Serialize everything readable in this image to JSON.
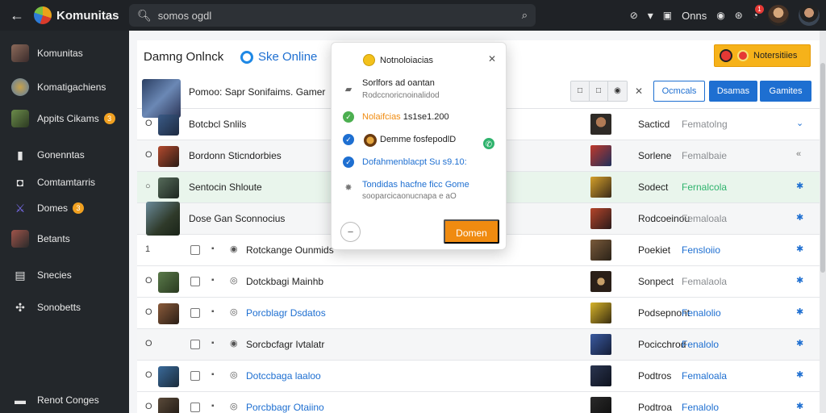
{
  "topbar": {
    "brand": "Komunitas",
    "search_value": "somos ogdl",
    "right_text": "Onns",
    "notif_count": "1",
    "icons": [
      "back-arrow-icon",
      "search-icon",
      "chevron-down-icon",
      "clipboard-icon",
      "chat-icon",
      "search-icon",
      "notification-icon"
    ]
  },
  "sidebar": {
    "items": [
      {
        "label": "Komunitas"
      },
      {
        "label": "Komatigachiens"
      },
      {
        "label": "Appits Cikams",
        "badge": "3"
      },
      {
        "label": "Gonenntas"
      },
      {
        "label": "Comtamtarris"
      },
      {
        "label": "Domes",
        "badge": "3"
      },
      {
        "label": "Betants"
      },
      {
        "label": "Snecies"
      },
      {
        "label": "Sonobetts"
      },
      {
        "label": "Renot Conges"
      }
    ]
  },
  "main": {
    "title": "Damng Onlnck",
    "status_label": "Ske Online",
    "notif_button": "Notersitiies",
    "header": {
      "text": "Pomoo: Sapr  Sonifaims.  Gamer",
      "seg": [
        "□",
        "□",
        "◉"
      ],
      "btn_outline": "Ocmcals",
      "btn_solid1": "Dsamas",
      "btn_solid2": "Gamites"
    },
    "rows": [
      {
        "num": "O",
        "name": "Botcbcl Snlils",
        "col1": "Sacticd",
        "col2": "Fematolng",
        "act": "⌄"
      },
      {
        "num": "O",
        "name": "Bordonn Sticndorbies",
        "col1": "Sorlene",
        "col2": "Femalbaie",
        "act": "«"
      },
      {
        "num": "○",
        "name": "Sentocin Shloute",
        "col1": "Sodect",
        "col2": "Fernalcola",
        "act": "✱"
      },
      {
        "num": "",
        "name": "Dose Gan Sconnocius",
        "col1": "Rodcoeinou",
        "col2": "Femaloala",
        "act": "✱"
      },
      {
        "num": "1",
        "name": "Rotckange Ounmids",
        "col1": "Poekiet",
        "col2": "Fensloiio",
        "act": "✱"
      },
      {
        "num": "O",
        "name": "Dotckbagi Mainhb",
        "col1": "Sonpect",
        "col2": "Femalaola",
        "act": "✱"
      },
      {
        "num": "O",
        "name": "Porcblagr Dsdatos",
        "col1": "Podsepnont",
        "col2": "Fenalolio",
        "act": "✱"
      },
      {
        "num": "O",
        "name": "Sorcbcfagr Ivtalatr",
        "col1": "Pocicchrod",
        "col2": "Fenalolo",
        "act": "✱"
      },
      {
        "num": "O",
        "name": "Dotccbaga laaloo",
        "col1": "Podtros",
        "col2": "Femaloala",
        "act": "✱"
      },
      {
        "num": "O",
        "name": "Porcbbagr Otaiino",
        "col1": "Podtroa",
        "col2": "Fenalolo",
        "act": "✱"
      }
    ]
  },
  "popup": {
    "title": "Notnoloiacias",
    "item1": "Sorlfors ad oantan",
    "item1_sub": "Rodccnoricnoinalidod",
    "item2_a": "Nolaifcias",
    "item2_b": "1s1se1.200",
    "item3": "Demme fosfepodlD",
    "item4": "Dofahmenblacpt Su s9.10:",
    "item5": "Tondidas hacfne ficc Gome",
    "item5_sub": "sooparcicaonucnapa e aO",
    "plus": "−",
    "button": "Domen"
  },
  "colors": {
    "accent": "#1e6fd1",
    "orange": "#f08b10",
    "sidebar": "#23272b",
    "topbar": "#1f2226"
  }
}
